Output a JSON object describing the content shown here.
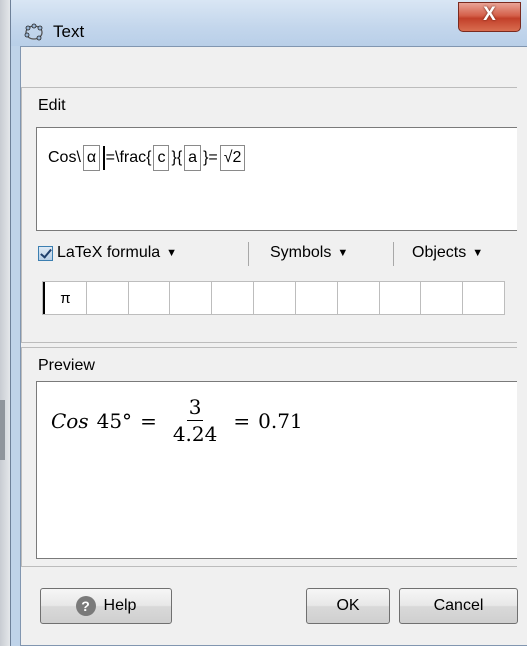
{
  "window": {
    "title": "Text",
    "close_symbol": "X"
  },
  "edit": {
    "section_label": "Edit",
    "expression": [
      {
        "type": "text",
        "value": "Cos\\"
      },
      {
        "type": "slot",
        "value": "α"
      },
      {
        "type": "caret"
      },
      {
        "type": "text",
        "value": "=\\frac{"
      },
      {
        "type": "slot",
        "value": "c"
      },
      {
        "type": "text",
        "value": "}{"
      },
      {
        "type": "slot",
        "value": "a"
      },
      {
        "type": "text",
        "value": "}="
      },
      {
        "type": "slot",
        "value": "√2"
      }
    ],
    "latex_checked": true,
    "latex_label": "LaTeX formula",
    "symbols_label": "Symbols",
    "objects_label": "Objects",
    "symbol_cells": [
      "π",
      "",
      "",
      "",
      "",
      "",
      "",
      "",
      "",
      "",
      ""
    ]
  },
  "preview": {
    "section_label": "Preview",
    "lhs_word": "Cos",
    "angle": "45°",
    "equals1": "=",
    "numerator": "3",
    "denominator": "4.24",
    "equals2": "=",
    "result": "0.71"
  },
  "buttons": {
    "help": "Help",
    "ok": "OK",
    "cancel": "Cancel"
  },
  "colors": {
    "title_bar": "#c3d6ec",
    "close_button": "#c9452f",
    "dialog_bg": "#f0f0f0"
  }
}
